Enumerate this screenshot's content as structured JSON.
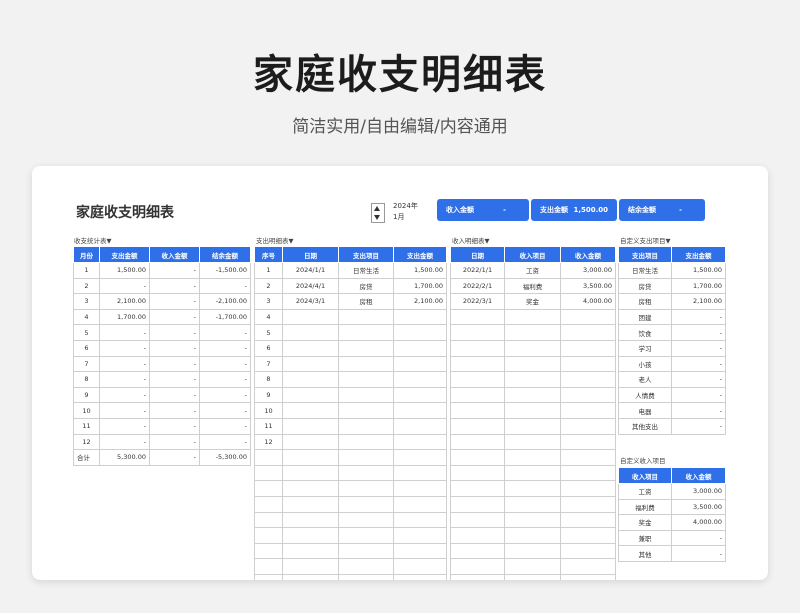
{
  "header": {
    "title": "家庭收支明细表",
    "subtitle": "简洁实用/自由编辑/内容通用"
  },
  "sheet": {
    "title": "家庭收支明细表",
    "year": "2024年",
    "month": "1月",
    "summary": [
      {
        "label": "收入金额",
        "value": "-"
      },
      {
        "label": "支出金额",
        "value": "1,500.00"
      },
      {
        "label": "结余金额",
        "value": "-"
      }
    ]
  },
  "stats": {
    "title": "收支统计表▼",
    "headers": [
      "月份",
      "支出金额",
      "收入金额",
      "结余金额"
    ],
    "rows": [
      [
        "1",
        "1,500.00",
        "-",
        "-1,500.00"
      ],
      [
        "2",
        "-",
        "-",
        "-"
      ],
      [
        "3",
        "2,100.00",
        "-",
        "-2,100.00"
      ],
      [
        "4",
        "1,700.00",
        "-",
        "-1,700.00"
      ],
      [
        "5",
        "-",
        "-",
        "-"
      ],
      [
        "6",
        "-",
        "-",
        "-"
      ],
      [
        "7",
        "-",
        "-",
        "-"
      ],
      [
        "8",
        "-",
        "-",
        "-"
      ],
      [
        "9",
        "-",
        "-",
        "-"
      ],
      [
        "10",
        "-",
        "-",
        "-"
      ],
      [
        "11",
        "-",
        "-",
        "-"
      ],
      [
        "12",
        "-",
        "-",
        "-"
      ],
      [
        "合计",
        "5,300.00",
        "-",
        "-5,300.00"
      ]
    ]
  },
  "expense": {
    "title": "支出明细表▼",
    "headers": [
      "序号",
      "日期",
      "支出项目",
      "支出金额"
    ],
    "rows": [
      [
        "1",
        "2024/1/1",
        "日常生活",
        "1,500.00"
      ],
      [
        "2",
        "2024/4/1",
        "房贷",
        "1,700.00"
      ],
      [
        "3",
        "2024/3/1",
        "房租",
        "2,100.00"
      ],
      [
        "4",
        "",
        "",
        ""
      ],
      [
        "5",
        "",
        "",
        ""
      ],
      [
        "6",
        "",
        "",
        ""
      ],
      [
        "7",
        "",
        "",
        ""
      ],
      [
        "8",
        "",
        "",
        ""
      ],
      [
        "9",
        "",
        "",
        ""
      ],
      [
        "10",
        "",
        "",
        ""
      ],
      [
        "11",
        "",
        "",
        ""
      ],
      [
        "12",
        "",
        "",
        ""
      ],
      [
        "",
        "",
        "",
        ""
      ],
      [
        "",
        "",
        "",
        ""
      ],
      [
        "",
        "",
        "",
        ""
      ],
      [
        "",
        "",
        "",
        ""
      ],
      [
        "",
        "",
        "",
        ""
      ],
      [
        "",
        "",
        "",
        ""
      ],
      [
        "",
        "",
        "",
        ""
      ],
      [
        "",
        "",
        "",
        ""
      ],
      [
        "",
        "",
        "",
        ""
      ]
    ]
  },
  "income": {
    "title": "收入明细表▼",
    "headers": [
      "日期",
      "收入项目",
      "收入金额"
    ],
    "rows": [
      [
        "2022/1/1",
        "工资",
        "3,000.00"
      ],
      [
        "2022/2/1",
        "福利费",
        "3,500.00"
      ],
      [
        "2022/3/1",
        "奖金",
        "4,000.00"
      ],
      [
        "",
        "",
        ""
      ],
      [
        "",
        "",
        ""
      ],
      [
        "",
        "",
        ""
      ],
      [
        "",
        "",
        ""
      ],
      [
        "",
        "",
        ""
      ],
      [
        "",
        "",
        ""
      ],
      [
        "",
        "",
        ""
      ],
      [
        "",
        "",
        ""
      ],
      [
        "",
        "",
        ""
      ],
      [
        "",
        "",
        ""
      ],
      [
        "",
        "",
        ""
      ],
      [
        "",
        "",
        ""
      ],
      [
        "",
        "",
        ""
      ],
      [
        "",
        "",
        ""
      ],
      [
        "",
        "",
        ""
      ],
      [
        "",
        "",
        ""
      ],
      [
        "",
        "",
        ""
      ],
      [
        "",
        "",
        ""
      ],
      [
        "",
        "",
        ""
      ]
    ]
  },
  "custom_expense": {
    "title": "自定义支出项目▼",
    "headers": [
      "支出项目",
      "支出金额"
    ],
    "rows": [
      [
        "日常生活",
        "1,500.00"
      ],
      [
        "房贷",
        "1,700.00"
      ],
      [
        "房租",
        "2,100.00"
      ],
      [
        "团建",
        "-"
      ],
      [
        "饮食",
        "-"
      ],
      [
        "学习",
        "-"
      ],
      [
        "小孩",
        "-"
      ],
      [
        "老人",
        "-"
      ],
      [
        "人情费",
        "-"
      ],
      [
        "电器",
        "-"
      ],
      [
        "其他支出",
        "-"
      ]
    ]
  },
  "custom_income": {
    "title": "自定义收入项目",
    "headers": [
      "收入项目",
      "收入金额"
    ],
    "rows": [
      [
        "工资",
        "3,000.00"
      ],
      [
        "福利费",
        "3,500.00"
      ],
      [
        "奖金",
        "4,000.00"
      ],
      [
        "兼职",
        "-"
      ],
      [
        "其他",
        "-"
      ]
    ]
  }
}
